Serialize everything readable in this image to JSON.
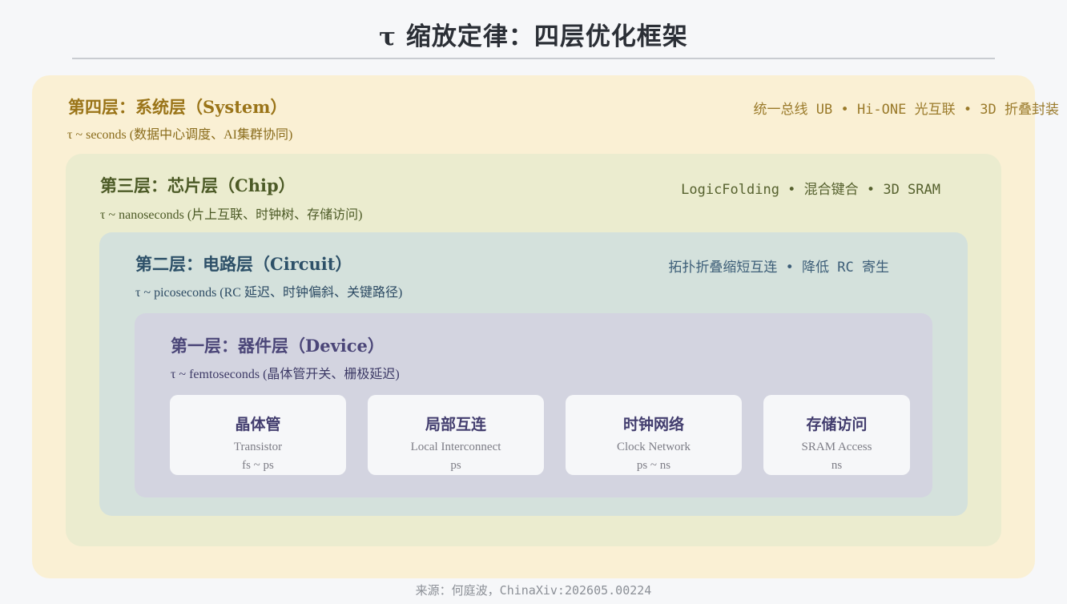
{
  "title": "τ 缩放定律：四层优化框架",
  "layers": [
    {
      "title": "第四层：系统层（System）",
      "subtitle": "τ ~ seconds (数据中心调度、AI集群协同)",
      "tags": "统一总线 UB • Hi-ONE 光互联 • 3D 折叠封装"
    },
    {
      "title": "第三层：芯片层（Chip）",
      "subtitle": "τ ~ nanoseconds (片上互联、时钟树、存储访问)",
      "tags": "LogicFolding • 混合键合 • 3D SRAM"
    },
    {
      "title": "第二层：电路层（Circuit）",
      "subtitle": "τ ~ picoseconds (RC 延迟、时钟偏斜、关键路径)",
      "tags": "拓扑折叠缩短互连 • 降低 RC 寄生"
    },
    {
      "title": "第一层：器件层（Device）",
      "subtitle": "τ ~ femtoseconds (晶体管开关、栅极延迟)",
      "tags": ""
    }
  ],
  "cards": [
    {
      "name": "晶体管",
      "en": "Transistor",
      "scale": "fs ~ ps"
    },
    {
      "name": "局部互连",
      "en": "Local Interconnect",
      "scale": "ps"
    },
    {
      "name": "时钟网络",
      "en": "Clock Network",
      "scale": "ps ~ ns"
    },
    {
      "name": "存储访问",
      "en": "SRAM Access",
      "scale": "ns"
    }
  ],
  "source": "来源：何庭波，ChinaXiv:202605.00224",
  "colors": {
    "system_bg": "#faf0d4",
    "chip_bg": "#ebeccf",
    "circuit_bg": "#d4e1dc",
    "device_bg": "#d3d4e0"
  }
}
